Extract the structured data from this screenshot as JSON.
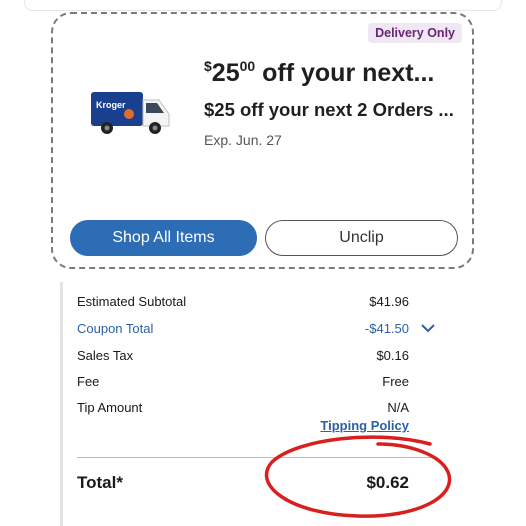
{
  "coupon": {
    "badge": "Delivery Only",
    "value_sup": "$",
    "value_main": "25",
    "value_cents": "00",
    "value_rest": " off your next...",
    "description": "$25 off your next 2 Orders ...",
    "expiration": "Exp. Jun. 27",
    "shop_button": "Shop All Items",
    "unclip_button": "Unclip",
    "truck_brand": "Kroger",
    "truck_color": "#1b3f8f"
  },
  "summary": {
    "estimated_subtotal_label": "Estimated Subtotal",
    "estimated_subtotal_value": "$41.96",
    "coupon_total_label": "Coupon Total",
    "coupon_total_value": "-$41.50",
    "sales_tax_label": "Sales Tax",
    "sales_tax_value": "$0.16",
    "fee_label": "Fee",
    "fee_value": "Free",
    "tip_label": "Tip Amount",
    "tip_value": "N/A",
    "tipping_policy_link": "Tipping Policy",
    "total_label": "Total*",
    "total_value": "$0.62"
  },
  "colors": {
    "primary": "#2d6db5",
    "link": "#2a62a6",
    "badge_bg": "#efe8f2",
    "badge_text": "#6a2479",
    "annotation": "#d8201f"
  }
}
